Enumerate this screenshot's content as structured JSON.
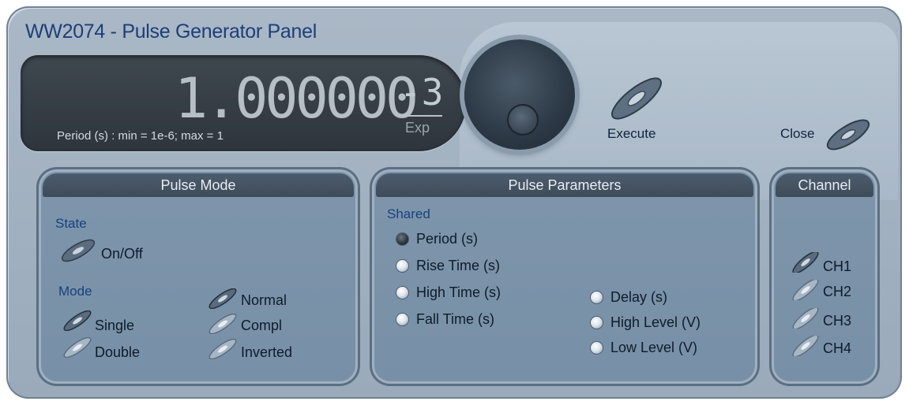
{
  "window": {
    "title": "WW2074 - Pulse Generator Panel"
  },
  "display": {
    "value": "1.000000",
    "exponent": "-3",
    "exp_label": "Exp",
    "caption": "Period (s) : min = 1e-6; max = 1"
  },
  "controls": {
    "execute_label": "Execute",
    "close_label": "Close"
  },
  "pulse_mode": {
    "title": "Pulse Mode",
    "state_heading": "State",
    "onoff_label": "On/Off",
    "mode_heading": "Mode",
    "single_label": "Single",
    "double_label": "Double",
    "normal_label": "Normal",
    "compl_label": "Compl",
    "inverted_label": "Inverted"
  },
  "pulse_params": {
    "title": "Pulse Parameters",
    "shared_heading": "Shared",
    "period": "Period (s)",
    "rise": "Rise Time (s)",
    "high_time": "High Time (s)",
    "fall": "Fall Time (s)",
    "delay": "Delay (s)",
    "high_level": "High Level (V)",
    "low_level": "Low Level (V)",
    "selected": "Period (s)"
  },
  "channel": {
    "title": "Channel",
    "ch1": "CH1",
    "ch2": "CH2",
    "ch3": "CH3",
    "ch4": "CH4"
  },
  "colors": {
    "panel": "#9fb0c1",
    "title_text": "#1c3f78",
    "display_bg": "#343b42",
    "group_bg": "#7c93aa"
  }
}
